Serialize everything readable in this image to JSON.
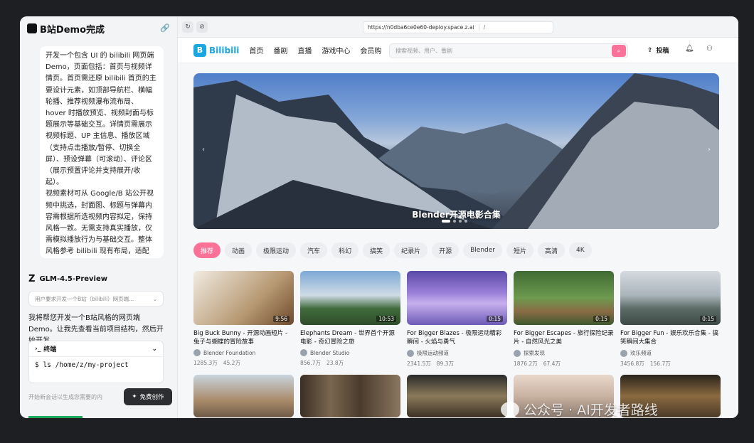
{
  "chat": {
    "title": "B站Demo完成",
    "user_message": [
      "开发一个包含 UI 的 bilibili 网页端 Demo，页面包括：首页与视频详情页。首页需还原 bilibili 首页的主要设计元素，如顶部导航栏、横幅轮播、推荐视频瀑布流布局、hover 时播放预览、视频封面与标题展示等基础交互。详情页需展示视频标题、UP 主信息、播放区域（支持点击播放/暂停、切换全屏）、预设弹幕（可滚动）、评论区（展示预置评论并支持展开/收起）。",
      "视频素材可从 Google/B 站公开视频中挑选，封面图、标题与弹幕内容需根据所选视频内容拟定，保持风格一致。无需支持真实播放，仅需模拟播放行为与基础交互。整体风格参考 bilibili 现有布局，适配 PC 浏览器展示。"
    ],
    "model_name": "GLM-4.5-Preview",
    "thinking_text": "用户要求开发一个B站（bilibili）网页端...",
    "reply": "我将帮您开发一个B站风格的网页端Demo。让我先查看当前项目结构，然后开始开发。",
    "terminal_title": "终端",
    "terminal_cmd": "$ ls /home/z/my-project",
    "input_placeholder": "开始新会话以生成您需要的内",
    "create_label": "免费创作"
  },
  "browser": {
    "url": "https://n0dba6ce0e60-deploy.space.z.ai",
    "path": "/"
  },
  "site": {
    "brand": "Bilibili",
    "brand_letter": "B",
    "nav": [
      "首页",
      "番剧",
      "直播",
      "游戏中心",
      "会员购"
    ],
    "search_placeholder": "搜索视频、用户、番剧",
    "upload_label": "投稿",
    "banner_title": "Blender开源电影合集",
    "categories": [
      "推荐",
      "动画",
      "极限运动",
      "汽车",
      "科幻",
      "搞笑",
      "纪录片",
      "开源",
      "Blender",
      "短片",
      "高清",
      "4K"
    ],
    "videos": [
      {
        "title": "Big Buck Bunny - 开源动画短片 - 兔子与蝴蝶的冒险故事",
        "author": "Blender Foundation",
        "views": "1285.3万",
        "likes": "45.2万",
        "duration": "9:56"
      },
      {
        "title": "Elephants Dream - 世界首个开源电影 - 奇幻冒险之旅",
        "author": "Blender Studio",
        "views": "856.7万",
        "likes": "23.8万",
        "duration": "10:53"
      },
      {
        "title": "For Bigger Blazes - 极限运动精彩瞬间 - 火焰与勇气",
        "author": "极限运动频道",
        "views": "2341.5万",
        "likes": "89.3万",
        "duration": "0:15"
      },
      {
        "title": "For Bigger Escapes - 旅行探险纪录片 - 自然风光之美",
        "author": "探索发现",
        "views": "1876.2万",
        "likes": "67.4万",
        "duration": "0:15"
      },
      {
        "title": "For Bigger Fun - 娱乐欢乐合集 - 搞笑瞬间大集合",
        "author": "欢乐频道",
        "views": "3456.8万",
        "likes": "156.7万",
        "duration": "0:15"
      }
    ]
  },
  "watermark": "公众号 · AI开发者路线",
  "colors": {
    "accent": "#fb7299",
    "brand": "#1aa6e0"
  }
}
